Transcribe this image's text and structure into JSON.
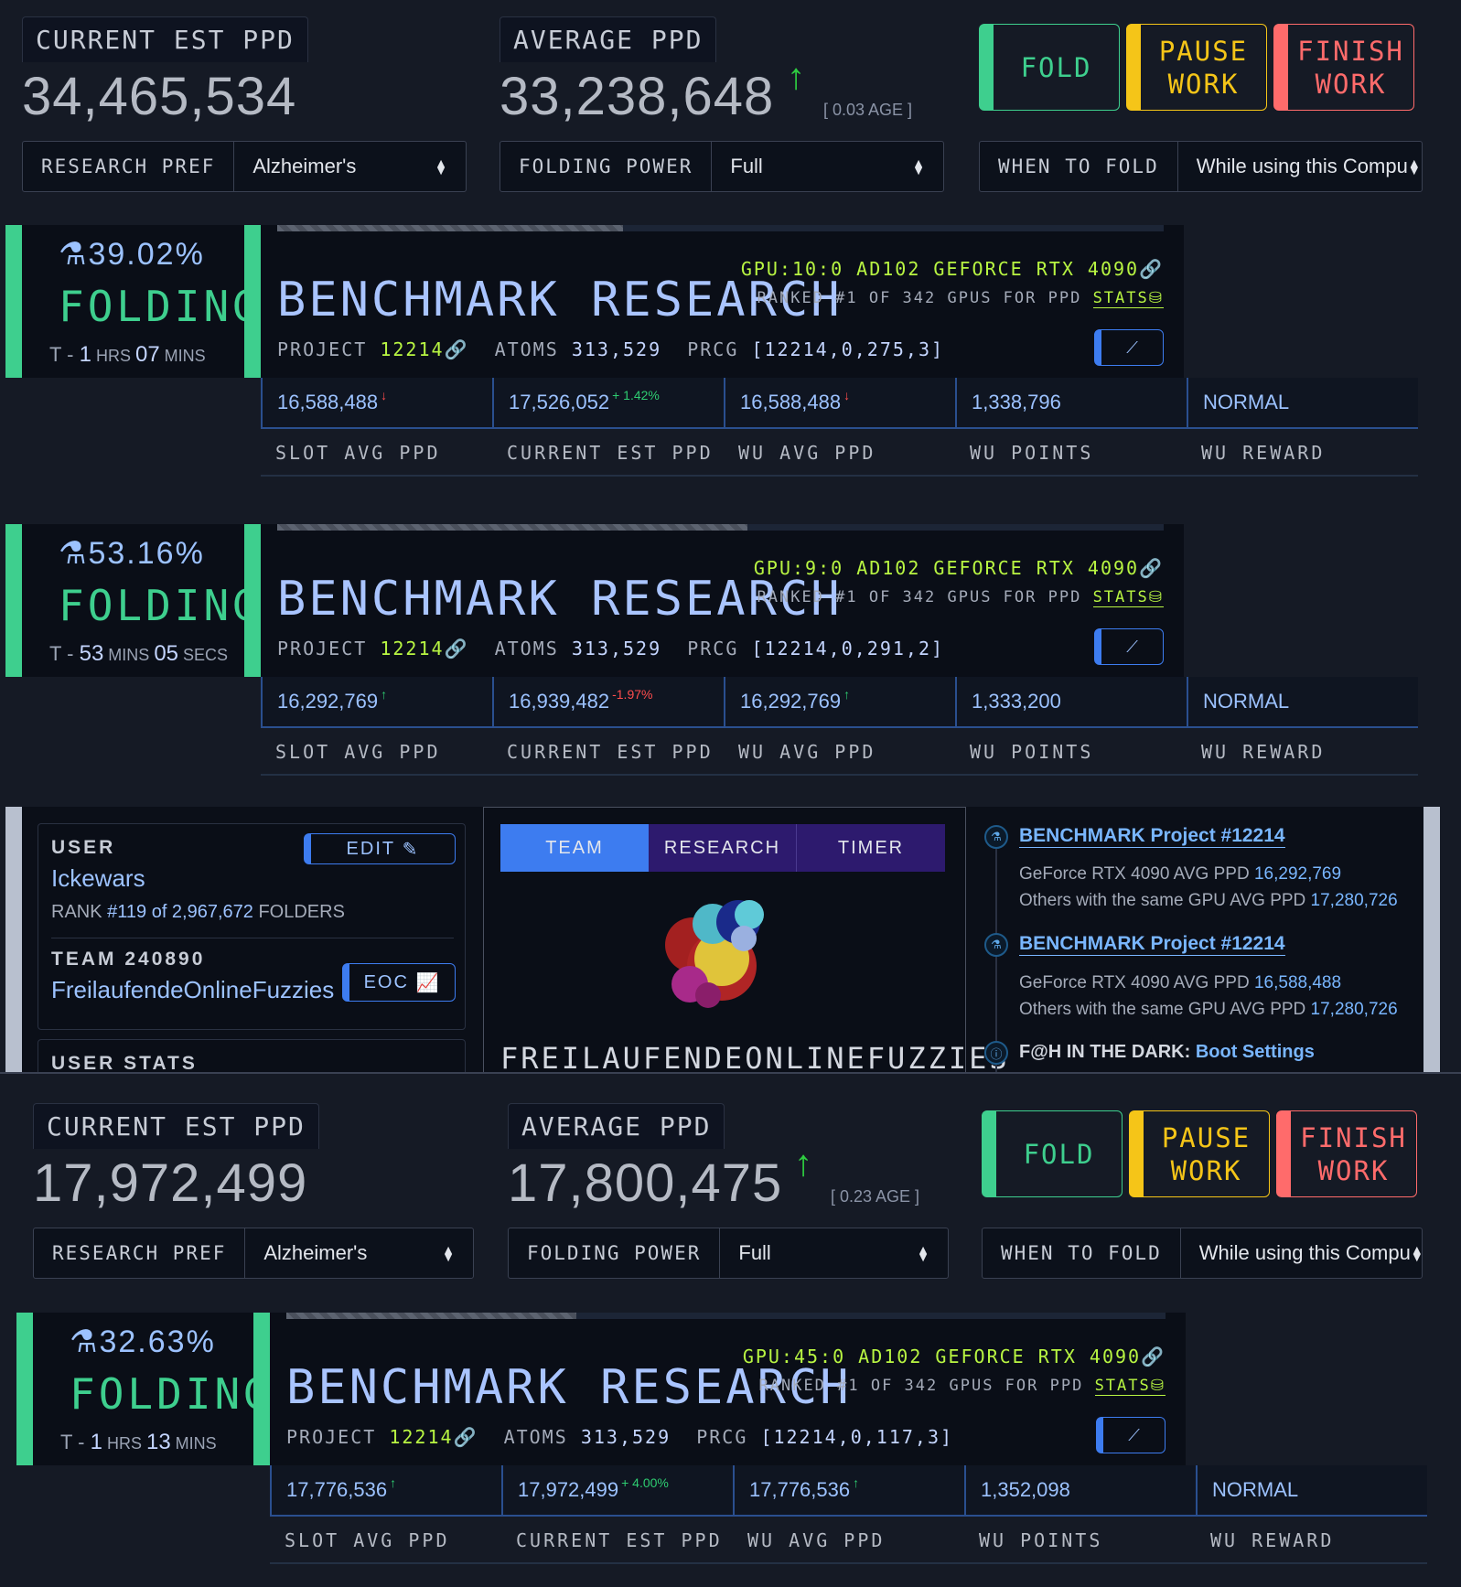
{
  "top": {
    "current_est_label": "CURRENT EST PPD",
    "current_est_value": "34,465,534",
    "average_label": "AVERAGE PPD",
    "average_value": "33,238,648",
    "age": "[ 0.03 AGE ]",
    "research_pref_label": "RESEARCH PREF",
    "research_pref_value": "Alzheimer's",
    "folding_power_label": "FOLDING POWER",
    "folding_power_value": "Full",
    "when_label": "WHEN TO FOLD",
    "when_value": "While using this Compu",
    "fold_label": "FOLD",
    "pause_line1": "PAUSE",
    "pause_line2": "WORK",
    "finish_line1": "FINISH",
    "finish_line2": "WORK"
  },
  "bottom": {
    "current_est_label": "CURRENT EST PPD",
    "current_est_value": "17,972,499",
    "average_label": "AVERAGE PPD",
    "average_value": "17,800,475",
    "age": "[ 0.23 AGE ]",
    "research_pref_label": "RESEARCH PREF",
    "research_pref_value": "Alzheimer's",
    "folding_power_label": "FOLDING POWER",
    "folding_power_value": "Full",
    "when_label": "WHEN TO FOLD",
    "when_value": "While using this Compu",
    "fold_label": "FOLD",
    "pause_line1": "PAUSE",
    "pause_line2": "WORK",
    "finish_line1": "FINISH",
    "finish_line2": "WORK"
  },
  "slots": [
    {
      "percent": "39.02%",
      "progress": 0.39,
      "status": "FOLDING",
      "eta_prefix": "T - ",
      "eta_a": "1",
      "eta_a_unit": " HRS ",
      "eta_b": "07",
      "eta_b_unit": " MINS",
      "title": "BENCHMARK RESEARCH",
      "project_label": "PROJECT",
      "project": "12214",
      "atoms_label": "ATOMS",
      "atoms": "313,529",
      "prcg_label": "PRCG",
      "prcg": "[12214,0,275,3]",
      "gpu": "GPU:10:0 AD102 GEFORCE RTX 4090",
      "ranked": "RANKED #1 OF 342 GPUS FOR PPD",
      "stats": "STATS",
      "cells": [
        {
          "value": "16,588,488",
          "delta": "↓",
          "delta_class": "red"
        },
        {
          "value": "17,526,052",
          "delta": "+ 1.42%",
          "delta_class": "grn"
        },
        {
          "value": "16,588,488",
          "delta": "↓",
          "delta_class": "red"
        },
        {
          "value": "1,338,796",
          "delta": "",
          "delta_class": ""
        },
        {
          "value": "NORMAL",
          "delta": "",
          "delta_class": ""
        }
      ],
      "labels": [
        "SLOT AVG PPD",
        "CURRENT EST PPD",
        "WU AVG PPD",
        "WU POINTS",
        "WU REWARD"
      ]
    },
    {
      "percent": "53.16%",
      "progress": 0.53,
      "status": "FOLDING",
      "eta_prefix": "T - ",
      "eta_a": "53",
      "eta_a_unit": " MINS ",
      "eta_b": "05",
      "eta_b_unit": " SECS",
      "title": "BENCHMARK RESEARCH",
      "project_label": "PROJECT",
      "project": "12214",
      "atoms_label": "ATOMS",
      "atoms": "313,529",
      "prcg_label": "PRCG",
      "prcg": "[12214,0,291,2]",
      "gpu": "GPU:9:0 AD102 GEFORCE RTX 4090",
      "ranked": "RANKED #1 OF 342 GPUS FOR PPD",
      "stats": "STATS",
      "cells": [
        {
          "value": "16,292,769",
          "delta": "↑",
          "delta_class": "grn"
        },
        {
          "value": "16,939,482",
          "delta": "-1.97%",
          "delta_class": "red"
        },
        {
          "value": "16,292,769",
          "delta": "↑",
          "delta_class": "grn"
        },
        {
          "value": "1,333,200",
          "delta": "",
          "delta_class": ""
        },
        {
          "value": "NORMAL",
          "delta": "",
          "delta_class": ""
        }
      ],
      "labels": [
        "SLOT AVG PPD",
        "CURRENT EST PPD",
        "WU AVG PPD",
        "WU POINTS",
        "WU REWARD"
      ]
    },
    {
      "percent": "32.63%",
      "progress": 0.33,
      "status": "FOLDING",
      "eta_prefix": "T - ",
      "eta_a": "1",
      "eta_a_unit": " HRS ",
      "eta_b": "13",
      "eta_b_unit": " MINS",
      "title": "BENCHMARK RESEARCH",
      "project_label": "PROJECT",
      "project": "12214",
      "atoms_label": "ATOMS",
      "atoms": "313,529",
      "prcg_label": "PRCG",
      "prcg": "[12214,0,117,3]",
      "gpu": "GPU:45:0 AD102 GEFORCE RTX 4090",
      "ranked": "RANKED #1 OF 342 GPUS FOR PPD",
      "stats": "STATS",
      "cells": [
        {
          "value": "17,776,536",
          "delta": "↑",
          "delta_class": "grn"
        },
        {
          "value": "17,972,499",
          "delta": "+ 4.00%",
          "delta_class": "grn"
        },
        {
          "value": "17,776,536",
          "delta": "↑",
          "delta_class": "grn"
        },
        {
          "value": "1,352,098",
          "delta": "",
          "delta_class": ""
        },
        {
          "value": "NORMAL",
          "delta": "",
          "delta_class": ""
        }
      ],
      "labels": [
        "SLOT AVG PPD",
        "CURRENT EST PPD",
        "WU AVG PPD",
        "WU POINTS",
        "WU REWARD"
      ]
    }
  ],
  "user": {
    "user_label": "USER",
    "edit_label": "EDIT",
    "name": "Ickewars",
    "rank_prefix": "RANK ",
    "rank_value": "#119 of 2,967,672",
    "rank_suffix": " FOLDERS",
    "team_label": "TEAM",
    "team_id": "240890",
    "team_name": "FreilaufendeOnlineFuzzies",
    "eoc_label": "EOC",
    "stats_label": "USER STATS"
  },
  "tabs": [
    "TEAM",
    "RESEARCH",
    "TIMER"
  ],
  "team_banner": "FREILAUFENDEONLINEFUZZIES",
  "news": [
    {
      "title": "BENCHMARK Project #12214",
      "line1_prefix": "GeForce RTX 4090 AVG PPD ",
      "line1_value": "16,292,769",
      "line2_prefix": "Others with the same GPU AVG PPD ",
      "line2_value": "17,280,726"
    },
    {
      "title": "BENCHMARK Project #12214",
      "line1_prefix": "GeForce RTX 4090 AVG PPD ",
      "line1_value": "16,588,488",
      "line2_prefix": "Others with the same GPU AVG PPD ",
      "line2_value": "17,280,726"
    }
  ],
  "dark": {
    "prefix": "F@H IN THE DARK: ",
    "link": "Boot Settings"
  },
  "colors": {
    "green": "#3ecf8e",
    "yellow": "#f5c518",
    "red": "#ff6b6b",
    "blue": "#3d7cf0",
    "lime": "#b8f542"
  }
}
